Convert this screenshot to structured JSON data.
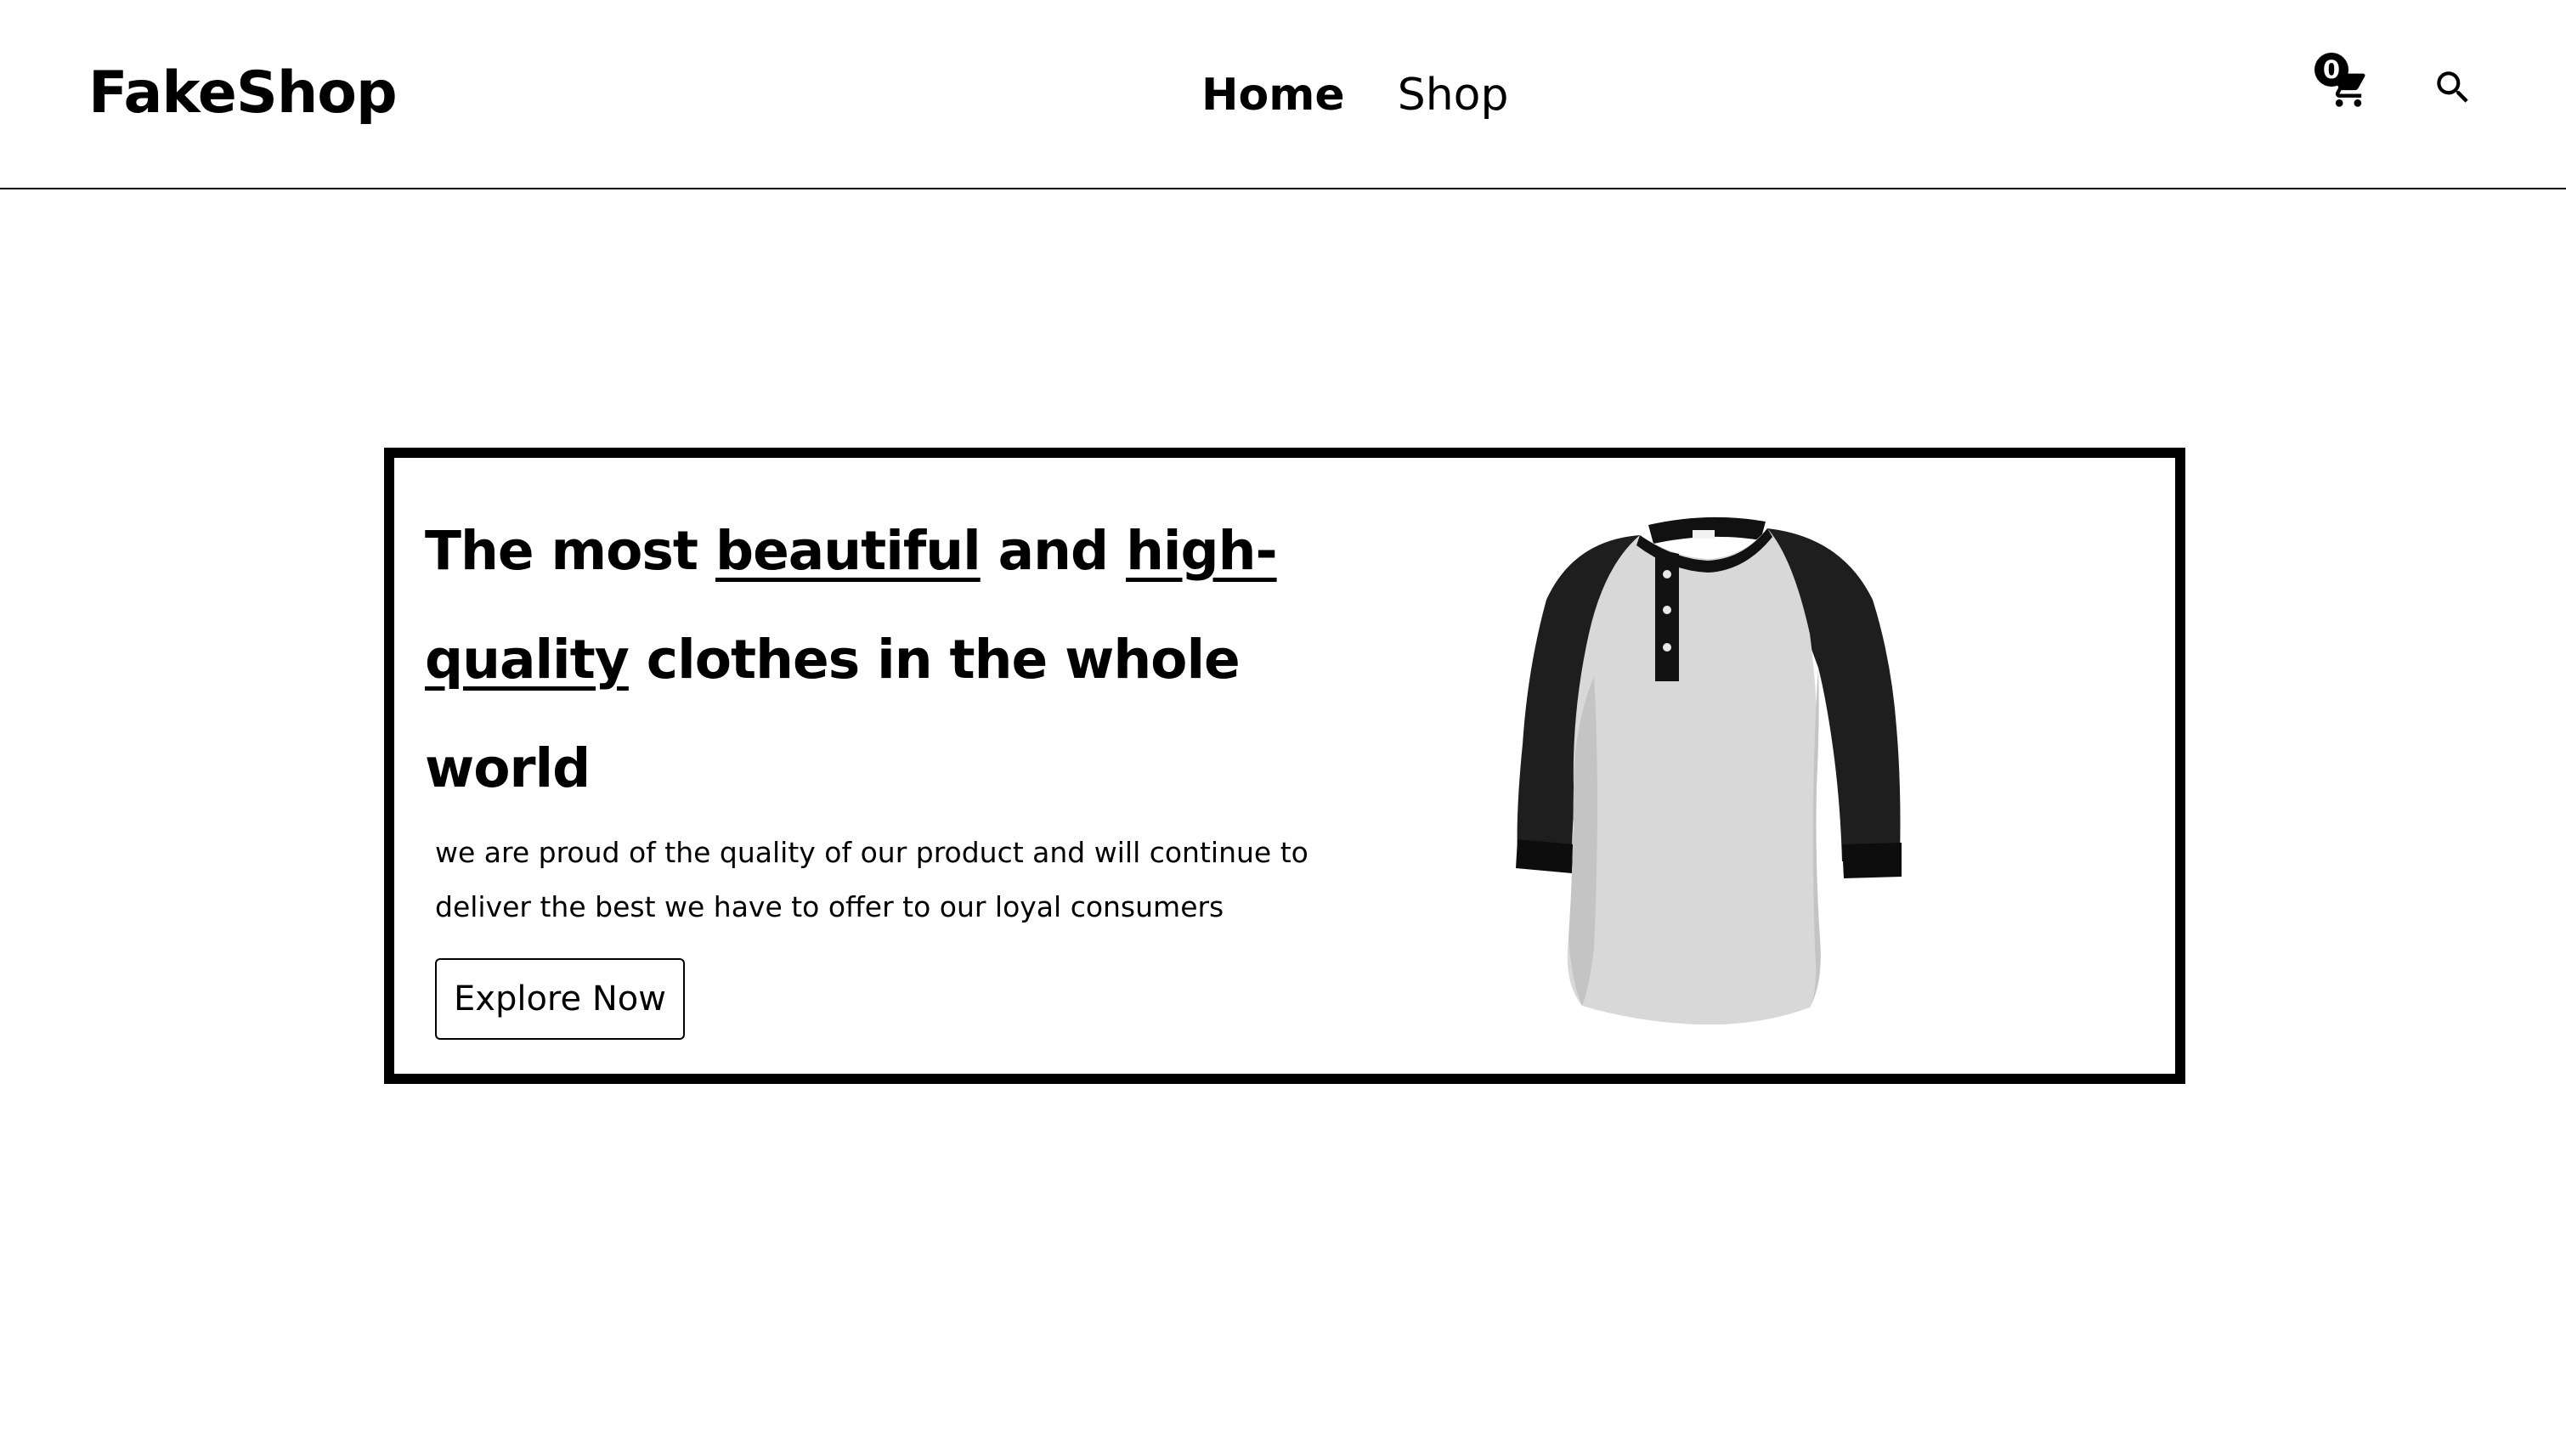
{
  "header": {
    "brand": "FakeShop",
    "nav": [
      {
        "label": "Home",
        "active": true
      },
      {
        "label": "Shop",
        "active": false
      }
    ],
    "cart": {
      "count": "0",
      "icon": "shopping-cart-icon"
    },
    "search": {
      "icon": "search-icon"
    }
  },
  "hero": {
    "headline": {
      "part1": "The most ",
      "emphasis1": "beautiful",
      "part2": " and ",
      "emphasis2": "high-quality",
      "part3": " clothes in the whole world"
    },
    "description": "we are proud of the quality of our product and will continue to deliver the best we have to offer to our loyal consumers",
    "cta_label": "Explore Now",
    "image": "henley-shirt-image"
  },
  "colors": {
    "text": "#000000",
    "background": "#ffffff",
    "shirt_body": "#d9d9d9",
    "shirt_sleeve": "#1a1a1a"
  }
}
